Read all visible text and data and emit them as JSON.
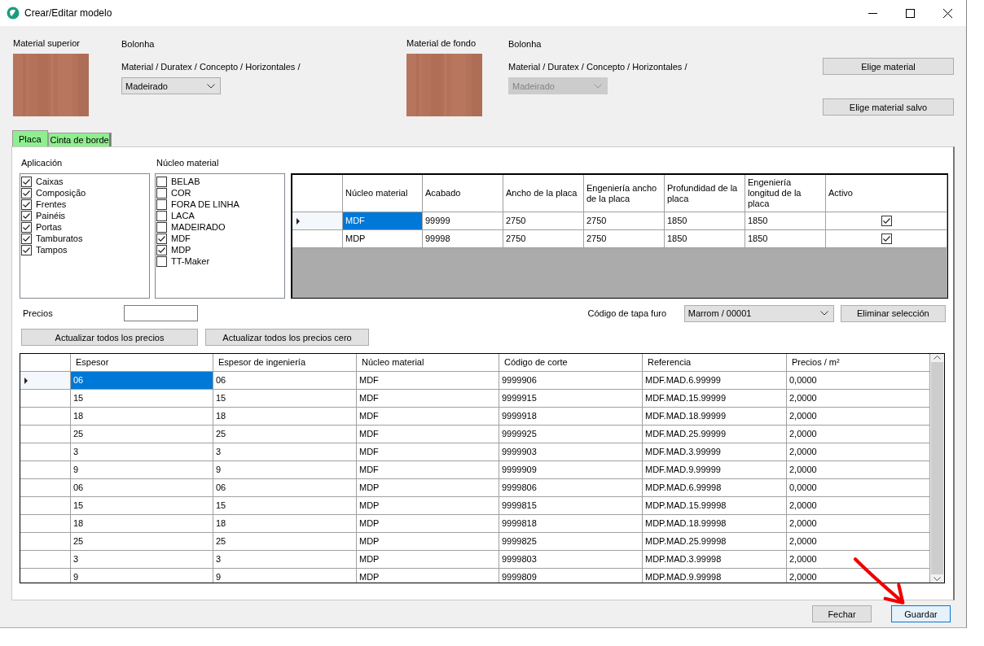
{
  "window": {
    "title": "Crear/Editar modelo"
  },
  "materials": [
    {
      "label": "Material superior",
      "name": "Bolonha",
      "path": "Material / Duratex / Concepto / Horizontales /",
      "dropdown": {
        "value": "Madeirado",
        "disabled": false
      }
    },
    {
      "label": "Material de fondo",
      "name": "Bolonha",
      "path": "Material / Duratex / Concepto / Horizontales /",
      "dropdown": {
        "value": "Madeirado",
        "disabled": true
      }
    }
  ],
  "material_buttons": [
    "Elige material",
    "Elige material salvo"
  ],
  "tabs": [
    {
      "label": "Placa",
      "selected": true
    },
    {
      "label": "Cinta de borde",
      "selected": false
    }
  ],
  "lists": [
    {
      "label": "Aplicación",
      "items": [
        {
          "label": "Caixas",
          "checked": true
        },
        {
          "label": "Composição",
          "checked": true
        },
        {
          "label": "Frentes",
          "checked": true
        },
        {
          "label": "Painéis",
          "checked": true
        },
        {
          "label": "Portas",
          "checked": true
        },
        {
          "label": "Tamburatos",
          "checked": true
        },
        {
          "label": "Tampos",
          "checked": true
        }
      ]
    },
    {
      "label": "Núcleo material",
      "items": [
        {
          "label": "BELAB",
          "checked": false
        },
        {
          "label": "COR",
          "checked": false
        },
        {
          "label": "FORA DE LINHA",
          "checked": false
        },
        {
          "label": "LACA",
          "checked": false
        },
        {
          "label": "MADEIRADO",
          "checked": false
        },
        {
          "label": "MDF",
          "checked": true
        },
        {
          "label": "MDP",
          "checked": true
        },
        {
          "label": "TT-Maker",
          "checked": false
        }
      ]
    }
  ],
  "placa_table": {
    "columns": [
      "Núcleo material",
      "Acabado",
      "Ancho de la placa",
      "Engeniería ancho de la placa",
      "Profundidad de la placa",
      "Engeniería longitud de la placa",
      "Activo"
    ],
    "rows": [
      {
        "selected": true,
        "cells": [
          "MDF",
          "99999",
          "2750",
          "2750",
          "1850",
          "1850"
        ],
        "activo": true
      },
      {
        "selected": false,
        "cells": [
          "MDP",
          "99998",
          "2750",
          "2750",
          "1850",
          "1850"
        ],
        "activo": true
      }
    ]
  },
  "precios": {
    "label": "Precios"
  },
  "update_buttons": [
    "Actualizar todos los precios",
    "Actualizar todos los precios cero"
  ],
  "tapa_furo": {
    "label": "Código de tapa furo",
    "value": "Marrom / 00001"
  },
  "remove_button": "Eliminar selección",
  "grid": {
    "columns": [
      "Espesor",
      "Espesor de ingeniería",
      "Núcleo material",
      "Código de corte",
      "Referencia",
      "Precios / m²"
    ],
    "rows": [
      {
        "selected": true,
        "cells": [
          "06",
          "06",
          "MDF",
          "9999906",
          "MDF.MAD.6.99999",
          "0,0000"
        ]
      },
      {
        "selected": false,
        "cells": [
          "15",
          "15",
          "MDF",
          "9999915",
          "MDF.MAD.15.99999",
          "2,0000"
        ]
      },
      {
        "selected": false,
        "cells": [
          "18",
          "18",
          "MDF",
          "9999918",
          "MDF.MAD.18.99999",
          "2,0000"
        ]
      },
      {
        "selected": false,
        "cells": [
          "25",
          "25",
          "MDF",
          "9999925",
          "MDF.MAD.25.99999",
          "2,0000"
        ]
      },
      {
        "selected": false,
        "cells": [
          "3",
          "3",
          "MDF",
          "9999903",
          "MDF.MAD.3.99999",
          "2,0000"
        ]
      },
      {
        "selected": false,
        "cells": [
          "9",
          "9",
          "MDF",
          "9999909",
          "MDF.MAD.9.99999",
          "2,0000"
        ]
      },
      {
        "selected": false,
        "cells": [
          "06",
          "06",
          "MDP",
          "9999806",
          "MDP.MAD.6.99998",
          "0,0000"
        ]
      },
      {
        "selected": false,
        "cells": [
          "15",
          "15",
          "MDP",
          "9999815",
          "MDP.MAD.15.99998",
          "2,0000"
        ]
      },
      {
        "selected": false,
        "cells": [
          "18",
          "18",
          "MDP",
          "9999818",
          "MDP.MAD.18.99998",
          "2,0000"
        ]
      },
      {
        "selected": false,
        "cells": [
          "25",
          "25",
          "MDP",
          "9999825",
          "MDP.MAD.25.99998",
          "2,0000"
        ]
      },
      {
        "selected": false,
        "cells": [
          "3",
          "3",
          "MDP",
          "9999803",
          "MDP.MAD.3.99998",
          "2,0000"
        ]
      },
      {
        "selected": false,
        "cells": [
          "9",
          "9",
          "MDP",
          "9999809",
          "MDP.MAD.9.99998",
          "2,0000"
        ]
      }
    ]
  },
  "footer_buttons": [
    {
      "label": "Fechar",
      "default": false
    },
    {
      "label": "Guardar",
      "default": true
    }
  ]
}
